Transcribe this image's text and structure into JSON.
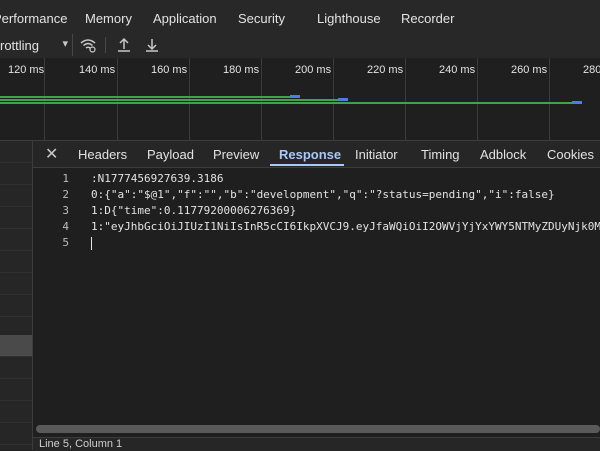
{
  "top_tabs": [
    "Performance",
    "Memory",
    "Application",
    "Security",
    "Lighthouse",
    "Recorder"
  ],
  "toolbar": {
    "throttle_label": "rottling",
    "throttle_arrow": "▾",
    "wifi_icon": "network-conditions-icon",
    "upload_icon": "upload-icon",
    "download_icon": "download-icon"
  },
  "timeline": {
    "ticks": [
      "120 ms",
      "140 ms",
      "160 ms",
      "180 ms",
      "200 ms",
      "220 ms",
      "240 ms",
      "260 ms",
      "280"
    ]
  },
  "detail": {
    "close_label": "✕",
    "tabs": [
      "Headers",
      "Payload",
      "Preview",
      "Response",
      "Initiator",
      "Timing",
      "Adblock",
      "Cookies"
    ],
    "active_tab": "Response",
    "line_numbers": [
      "1",
      "2",
      "3",
      "4",
      "5"
    ],
    "lines": [
      ":N1777456927639.3186",
      "0:{\"a\":\"$@1\",\"f\":\"\",\"b\":\"development\",\"q\":\"?status=pending\",\"i\":false}",
      "1:D{\"time\":0.11779200006276369}",
      "1:\"eyJhbGciOiJIUzI1NiIsInR5cCI6IkpXVCJ9.eyJfaWQiOiI2OWVjYjYxYWY5NTMyZDUyNjk0M",
      ""
    ],
    "status": "Line 5, Column 1"
  },
  "colors": {
    "accent": "#a8c7fa",
    "bar_green": "#3fa34d",
    "bar_blue": "#4c7ee0"
  }
}
